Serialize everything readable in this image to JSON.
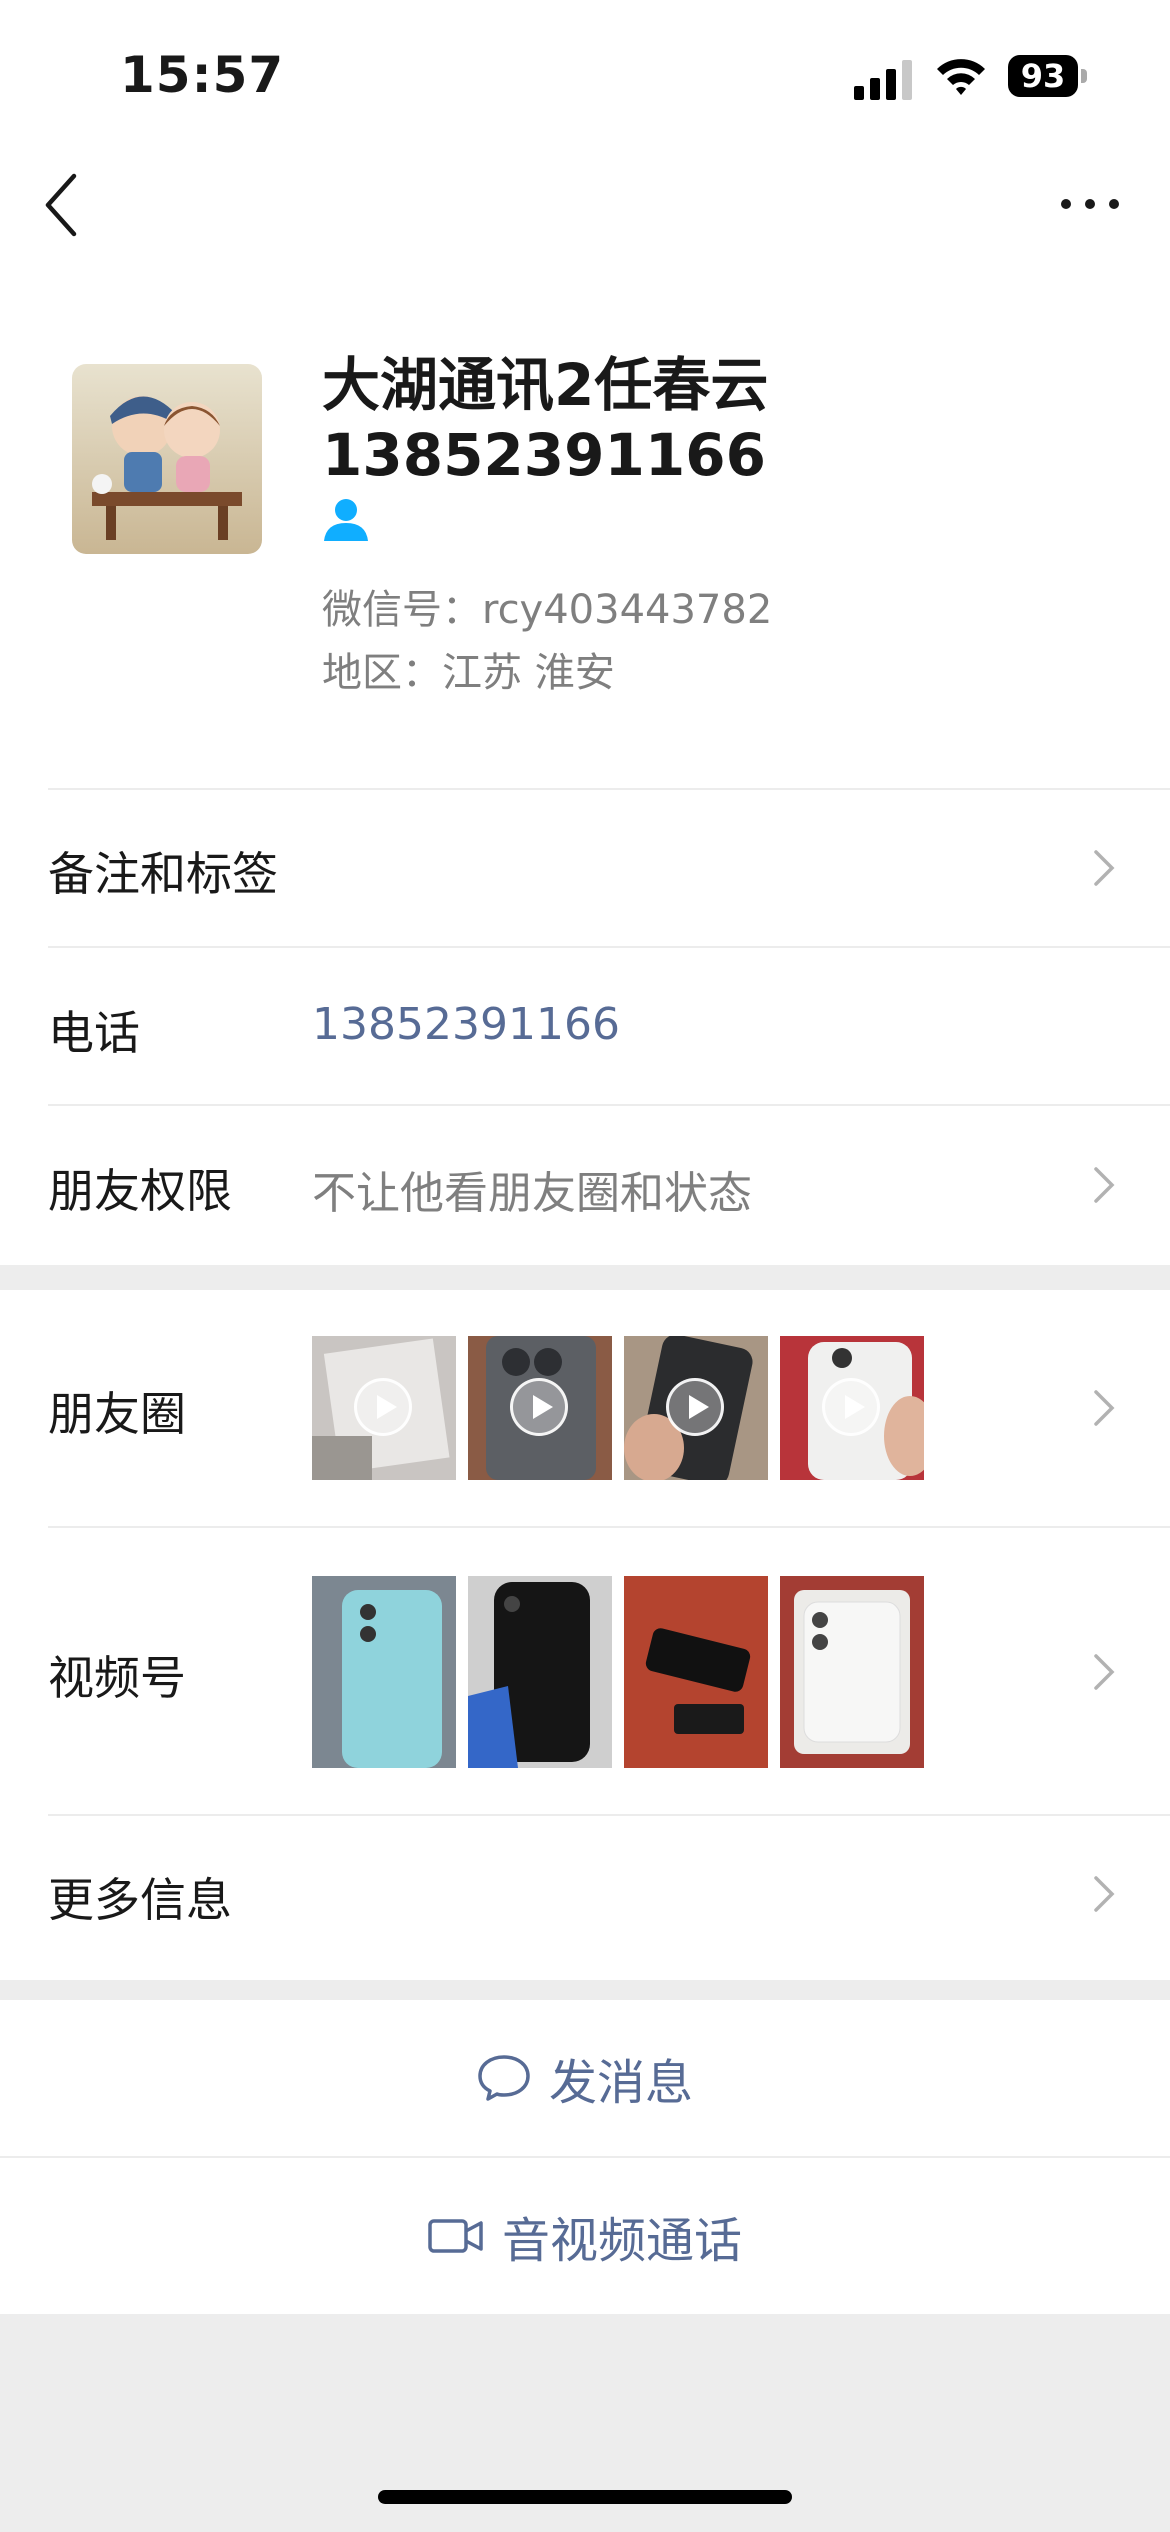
{
  "status_bar": {
    "time": "15:57",
    "battery": "93"
  },
  "profile": {
    "name": "大湖通讯2任春云",
    "phone_line": "13852391166",
    "wechat_id": "微信号：rcy403443782",
    "region": "地区：江苏 淮安"
  },
  "rows": {
    "remarks": {
      "label": "备注和标签"
    },
    "phone": {
      "label": "电话",
      "value": "13852391166"
    },
    "permission": {
      "label": "朋友权限",
      "value": "不让他看朋友圈和状态"
    },
    "moments": {
      "label": "朋友圈"
    },
    "channels": {
      "label": "视频号"
    },
    "more_info": {
      "label": "更多信息"
    }
  },
  "actions": {
    "message": "发消息",
    "call": "音视频通话"
  },
  "colors": {
    "link": "#576b95",
    "secondary": "#7f7f7f",
    "background": "#ededed"
  }
}
